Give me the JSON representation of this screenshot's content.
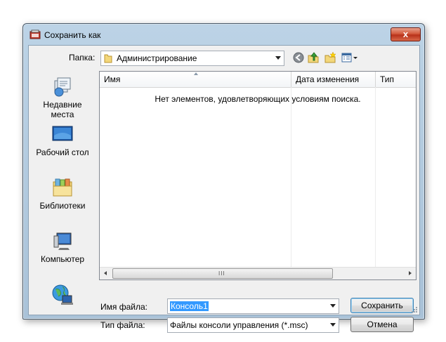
{
  "window": {
    "title": "Сохранить как",
    "close_label": "x"
  },
  "toolbar": {
    "folder_label": "Папка:",
    "folder_value": "Администрирование",
    "buttons": [
      "back-icon",
      "up-folder-icon",
      "new-folder-icon",
      "views-menu-icon"
    ]
  },
  "places": [
    {
      "icon": "recent-places-icon",
      "label_line1": "Недавние",
      "label_line2": "места"
    },
    {
      "icon": "desktop-icon",
      "label_line1": "Рабочий стол",
      "label_line2": ""
    },
    {
      "icon": "libraries-icon",
      "label_line1": "Библиотеки",
      "label_line2": ""
    },
    {
      "icon": "computer-icon",
      "label_line1": "Компьютер",
      "label_line2": ""
    },
    {
      "icon": "network-icon",
      "label_line1": "",
      "label_line2": ""
    }
  ],
  "filelist": {
    "columns": [
      "Имя",
      "Дата изменения",
      "Тип"
    ],
    "empty_message": "Нет элементов, удовлетворяющих условиям поиска.",
    "scroll_grip": "III"
  },
  "form": {
    "filename_label": "Имя файла:",
    "filename_value": "Консоль1",
    "filetype_label": "Тип файла:",
    "filetype_value": "Файлы консоли управления (*.msc)",
    "save_label": "Сохранить",
    "cancel_label": "Отмена"
  },
  "colors": {
    "accent": "#3399ff",
    "close": "#c94a2e",
    "title_bg": "#b6cde2"
  }
}
